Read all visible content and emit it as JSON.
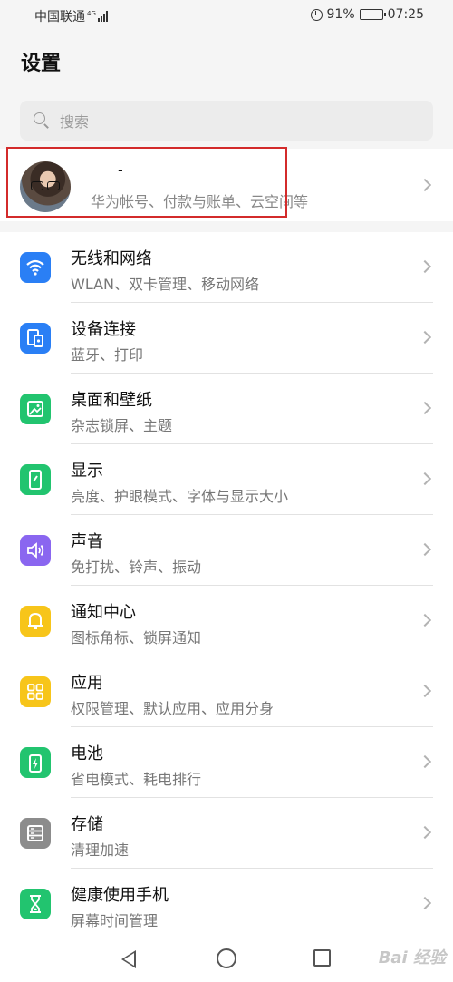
{
  "status_bar": {
    "carrier": "中国联通",
    "network_type": "4G",
    "battery_percent": "91%",
    "time": "07:25",
    "battery_level": 0.91
  },
  "page_title": "设置",
  "search": {
    "placeholder": "搜索"
  },
  "account": {
    "name": "-",
    "subtitle": "华为帐号、付款与账单、云空间等"
  },
  "settings": [
    {
      "title": "无线和网络",
      "subtitle": "WLAN、双卡管理、移动网络",
      "icon": "wifi-icon",
      "color": "#2a7ff5"
    },
    {
      "title": "设备连接",
      "subtitle": "蓝牙、打印",
      "icon": "device-connection-icon",
      "color": "#2a7ff5"
    },
    {
      "title": "桌面和壁纸",
      "subtitle": "杂志锁屏、主题",
      "icon": "wallpaper-icon",
      "color": "#22c46f"
    },
    {
      "title": "显示",
      "subtitle": "亮度、护眼模式、字体与显示大小",
      "icon": "display-icon",
      "color": "#22c46f"
    },
    {
      "title": "声音",
      "subtitle": "免打扰、铃声、振动",
      "icon": "sound-icon",
      "color": "#8a66f0"
    },
    {
      "title": "通知中心",
      "subtitle": "图标角标、锁屏通知",
      "icon": "bell-icon",
      "color": "#f7c51a"
    },
    {
      "title": "应用",
      "subtitle": "权限管理、默认应用、应用分身",
      "icon": "apps-grid-icon",
      "color": "#f7c51a"
    },
    {
      "title": "电池",
      "subtitle": "省电模式、耗电排行",
      "icon": "battery-icon",
      "color": "#22c46f"
    },
    {
      "title": "存储",
      "subtitle": "清理加速",
      "icon": "storage-icon",
      "color": "#8c8c8c"
    },
    {
      "title": "健康使用手机",
      "subtitle": "屏幕时间管理",
      "icon": "hourglass-icon",
      "color": "#22c46f"
    }
  ],
  "watermark": "Bai 经验"
}
